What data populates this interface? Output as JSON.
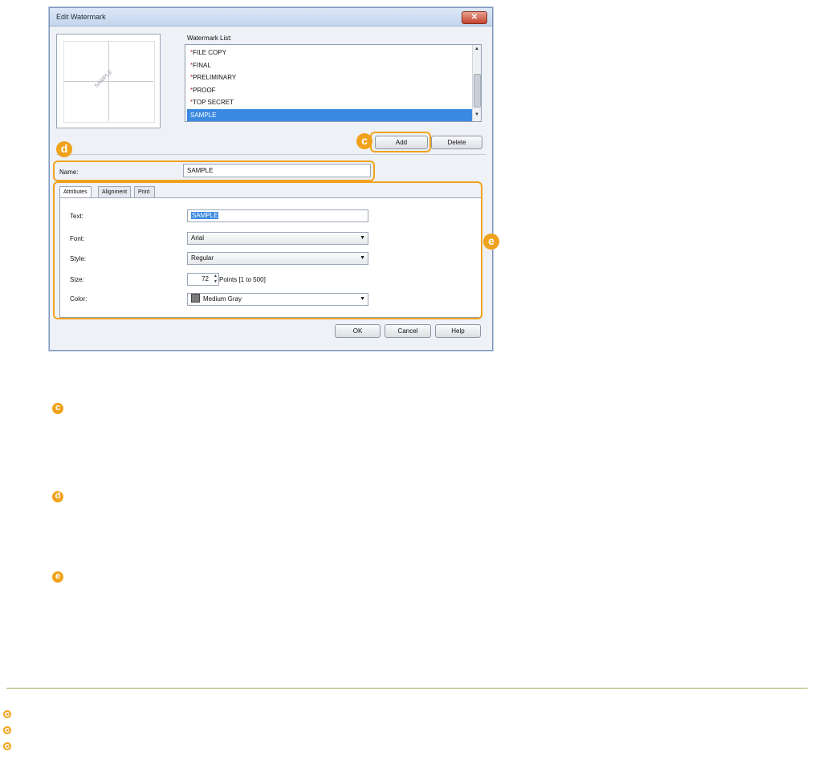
{
  "dialog": {
    "title": "Edit Watermark",
    "close_glyph": "✕",
    "preview_text": "SAMPLE",
    "watermark_list_label": "Watermark List:",
    "watermark_list": [
      {
        "label": "FILE COPY",
        "builtin": true
      },
      {
        "label": "FINAL",
        "builtin": true
      },
      {
        "label": "PRELIMINARY",
        "builtin": true
      },
      {
        "label": "PROOF",
        "builtin": true
      },
      {
        "label": "TOP SECRET",
        "builtin": true
      },
      {
        "label": "SAMPLE",
        "builtin": false,
        "selected": true
      }
    ],
    "add_label": "Add",
    "delete_label": "Delete",
    "name_label": "Name:",
    "name_value": "SAMPLE",
    "tabs": [
      "Attributes",
      "Alignment",
      "Print Style"
    ],
    "active_tab": "Attributes",
    "attributes": {
      "text_label": "Text:",
      "text_value": "SAMPLE",
      "font_label": "Font:",
      "font_value": "Arial",
      "style_label": "Style:",
      "style_value": "Regular",
      "size_label": "Size:",
      "size_value": "72",
      "size_unit": "Points [1 to 500]",
      "color_label": "Color:",
      "color_value": "Medium Gray",
      "color_swatch": "#7b7b7b"
    },
    "ok_label": "OK",
    "cancel_label": "Cancel",
    "help_label": "Help"
  },
  "callouts": {
    "c": "c",
    "d": "d",
    "e": "e"
  },
  "accent_color": "#f0a21c"
}
